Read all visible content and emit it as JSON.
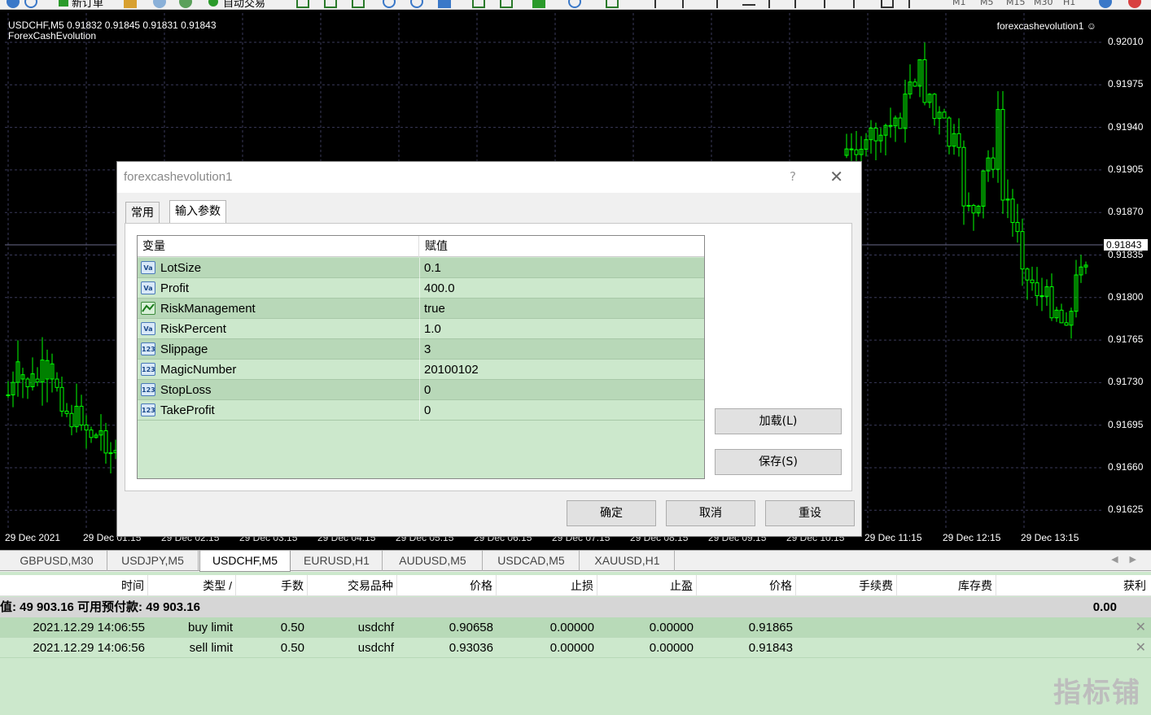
{
  "toolbar": {
    "new_order": "新订单",
    "auto_trade": "自动交易",
    "timeframes": [
      "M1",
      "M5",
      "M15",
      "M30",
      "H1"
    ]
  },
  "chart": {
    "header_line1": "USDCHF,M5  0.91832 0.91845 0.91831 0.91843",
    "header_line2": "ForexCashEvolution",
    "ea_label": "forexcashevolution1 ☺",
    "current_price": "0.91843",
    "price_labels": [
      "0.92010",
      "0.91975",
      "0.91940",
      "0.91905",
      "0.91870",
      "0.91835",
      "0.91800",
      "0.91765",
      "0.91730",
      "0.91695",
      "0.91660",
      "0.91625"
    ],
    "time_labels": [
      "29 Dec 2021",
      "29 Dec 01:15",
      "29 Dec 02:15",
      "29 Dec 03:15",
      "29 Dec 04:15",
      "29 Dec 05:15",
      "29 Dec 06:15",
      "29 Dec 07:15",
      "29 Dec 08:15",
      "29 Dec 09:15",
      "29 Dec 10:15",
      "29 Dec 11:15",
      "29 Dec 12:15",
      "29 Dec 13:15"
    ],
    "colors": {
      "bull": "#00ff00",
      "bear": "#00ff00",
      "grid": "#3a3a5a",
      "background": "#000000"
    }
  },
  "dialog": {
    "title": "forexcashevolution1",
    "help": "?",
    "close": "✕",
    "tabs": [
      "常用",
      "输入参数"
    ],
    "col_variable": "变量",
    "col_value": "赋值",
    "params": [
      {
        "icon": "Va",
        "name": "LotSize",
        "value": "0.1"
      },
      {
        "icon": "Va",
        "name": "Profit",
        "value": "400.0"
      },
      {
        "icon": "bool",
        "name": "RiskManagement",
        "value": "true"
      },
      {
        "icon": "Va",
        "name": "RiskPercent",
        "value": "1.0"
      },
      {
        "icon": "123",
        "name": "Slippage",
        "value": "3"
      },
      {
        "icon": "123",
        "name": "MagicNumber",
        "value": "20100102"
      },
      {
        "icon": "123",
        "name": "StopLoss",
        "value": "0"
      },
      {
        "icon": "123",
        "name": "TakeProfit",
        "value": "0"
      }
    ],
    "load": "加载(L)",
    "save": "保存(S)",
    "ok": "确定",
    "cancel": "取消",
    "reset": "重设"
  },
  "symbol_tabs": [
    "GBPUSD,M30",
    "USDJPY,M5",
    "USDCHF,M5",
    "EURUSD,H1",
    "AUDUSD,M5",
    "USDCAD,M5",
    "XAUUSD,H1"
  ],
  "symbol_tab_active": "USDCHF,M5",
  "terminal": {
    "headers": [
      "时间",
      "类型 /",
      "手数",
      "交易品种",
      "价格",
      "止损",
      "止盈",
      "价格",
      "手续费",
      "库存费",
      "获利"
    ],
    "balance_text": "值: 49 903.16  可用预付款: 49 903.16",
    "balance_profit": "0.00",
    "orders": [
      {
        "time": "2021.12.29 14:06:55",
        "type": "buy limit",
        "lots": "0.50",
        "symbol": "usdchf",
        "price": "0.90658",
        "sl": "0.00000",
        "tp": "0.00000",
        "cur": "0.91865"
      },
      {
        "time": "2021.12.29 14:06:56",
        "type": "sell limit",
        "lots": "0.50",
        "symbol": "usdchf",
        "price": "0.93036",
        "sl": "0.00000",
        "tp": "0.00000",
        "cur": "0.91843"
      }
    ]
  },
  "watermark": "指标铺"
}
